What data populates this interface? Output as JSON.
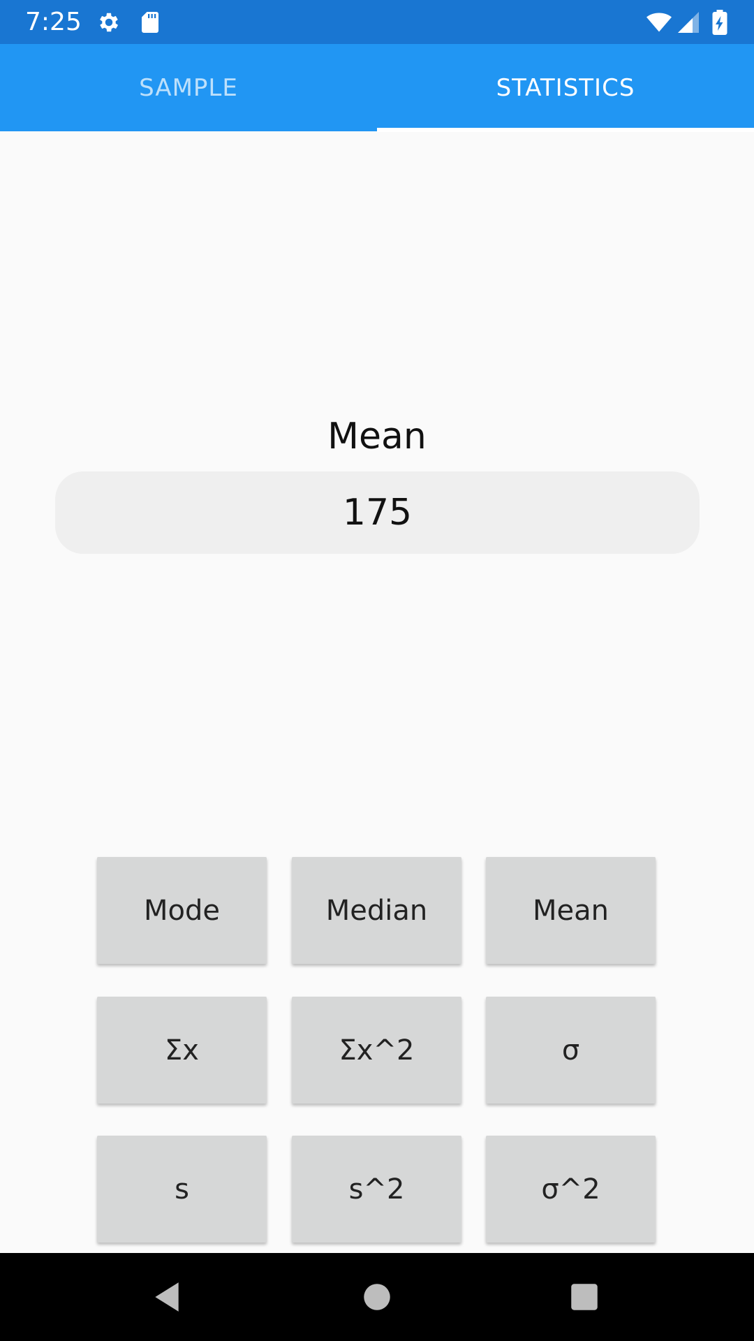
{
  "status_bar": {
    "time": "7:25",
    "icons": [
      "gear-icon",
      "sd-card-icon",
      "wifi-icon",
      "signal-icon",
      "battery-charging-icon"
    ],
    "color": "#1976D2"
  },
  "tabs": {
    "items": [
      {
        "label": "SAMPLE",
        "active": false
      },
      {
        "label": "STATISTICS",
        "active": true
      }
    ],
    "bar_color": "#2196F3"
  },
  "result": {
    "label": "Mean",
    "value": "175"
  },
  "buttons": [
    "Mode",
    "Median",
    "Mean",
    "Σx",
    "Σx^2",
    "σ",
    "s",
    "s^2",
    "σ^2"
  ],
  "nav_bar": {
    "icons": [
      "back-icon",
      "home-icon",
      "recents-icon"
    ]
  }
}
